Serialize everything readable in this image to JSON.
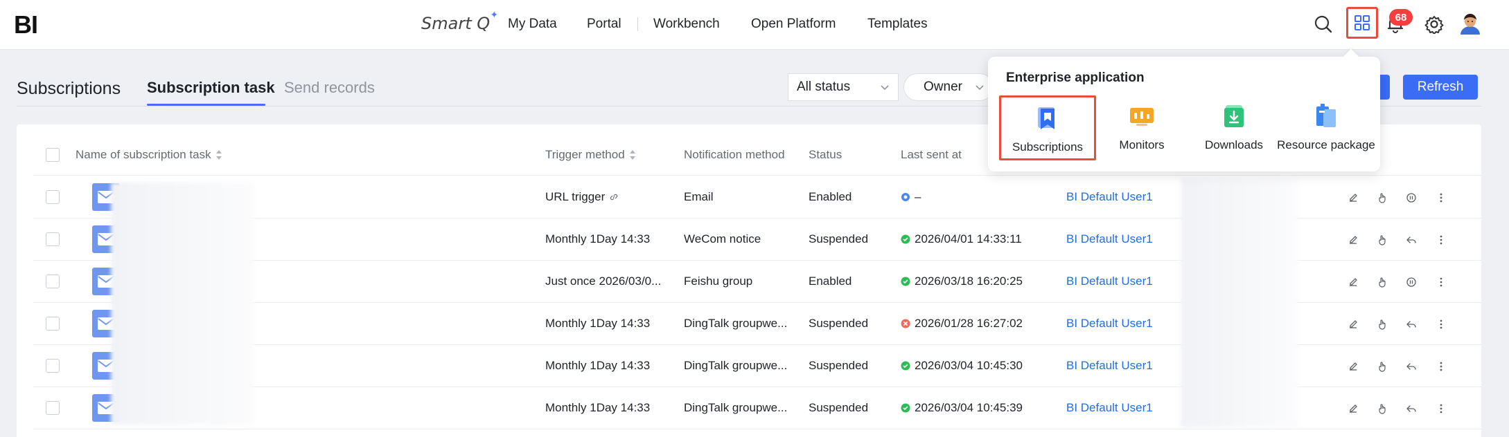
{
  "header": {
    "logo": "BI",
    "smart_q": "Smart Q",
    "nav": [
      "My Data",
      "Portal",
      "Workbench",
      "Open Platform",
      "Templates"
    ],
    "notification_count": "68"
  },
  "tabs_bar": {
    "title": "Subscriptions",
    "tabs": [
      "Subscription task",
      "Send records"
    ],
    "status_filter": "All status",
    "owner_filter": "Owner",
    "refresh_label": "Refresh"
  },
  "popup": {
    "title": "Enterprise application",
    "apps": [
      {
        "label": "Subscriptions",
        "icon": "bookmark-icon"
      },
      {
        "label": "Monitors",
        "icon": "monitor-icon"
      },
      {
        "label": "Downloads",
        "icon": "download-icon"
      },
      {
        "label": "Resource package",
        "icon": "package-icon"
      }
    ]
  },
  "table": {
    "headers": {
      "name": "Name of subscription task",
      "trigger": "Trigger method",
      "notification": "Notification method",
      "status": "Status",
      "last_sent": "Last sent at"
    },
    "rows": [
      {
        "trigger": "URL trigger",
        "notification": "Email",
        "status": "Enabled",
        "last_sent": "–",
        "last_state": "pending",
        "owner": "BI Default User1"
      },
      {
        "trigger": "Monthly 1Day 14:33",
        "notification": "WeCom notice",
        "status": "Suspended",
        "last_sent": "2026/04/01 14:33:11",
        "last_state": "success",
        "owner": "BI Default User1"
      },
      {
        "trigger": "Just once 2026/03/0...",
        "notification": "Feishu group",
        "status": "Enabled",
        "last_sent": "2026/03/18 16:20:25",
        "last_state": "success",
        "owner": "BI Default User1"
      },
      {
        "trigger": "Monthly 1Day 14:33",
        "notification": "DingTalk groupwe...",
        "status": "Suspended",
        "last_sent": "2026/01/28 16:27:02",
        "last_state": "error",
        "owner": "BI Default User1"
      },
      {
        "trigger": "Monthly 1Day 14:33",
        "notification": "DingTalk groupwe...",
        "status": "Suspended",
        "last_sent": "2026/03/04 10:45:30",
        "last_state": "success",
        "owner": "BI Default User1"
      },
      {
        "trigger": "Monthly 1Day 14:33",
        "notification": "DingTalk groupwe...",
        "status": "Suspended",
        "last_sent": "2026/03/04 10:45:39",
        "last_state": "success",
        "owner": "BI Default User1"
      }
    ]
  },
  "colors": {
    "primary": "#3a6cf5",
    "link": "#1e6ee8",
    "success": "#2dbb55",
    "error": "#f2685a",
    "highlight": "#e74c3c"
  }
}
